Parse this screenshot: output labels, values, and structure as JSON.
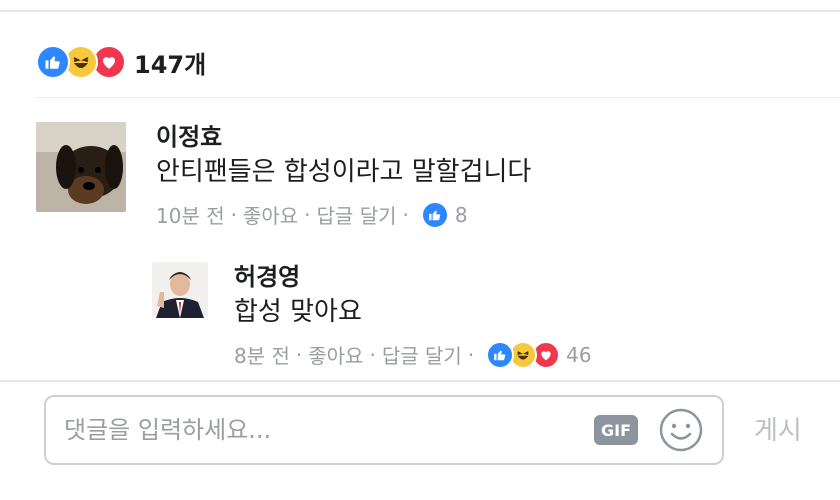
{
  "reactions": {
    "count_label": "147개",
    "types": [
      "like",
      "haha",
      "love"
    ]
  },
  "comments": [
    {
      "author": "이정효",
      "text": "안티팬들은 합성이라고 말할겁니다",
      "time": "10분 전",
      "like_label": "좋아요",
      "reply_label": "답글 달기",
      "reaction_count": "8",
      "reaction_types": [
        "like"
      ]
    },
    {
      "author": "허경영",
      "text": "합성 맞아요",
      "time": "8분 전",
      "like_label": "좋아요",
      "reply_label": "답글 달기",
      "reaction_count": "46",
      "reaction_types": [
        "like",
        "haha",
        "love"
      ]
    }
  ],
  "composer": {
    "placeholder": "댓글을 입력하세요...",
    "gif_label": "GIF",
    "post_label": "게시"
  },
  "colors": {
    "like": "#2d88ff",
    "haha": "#f7c83b",
    "love": "#f0374f",
    "meta_text": "#9a9da3"
  }
}
